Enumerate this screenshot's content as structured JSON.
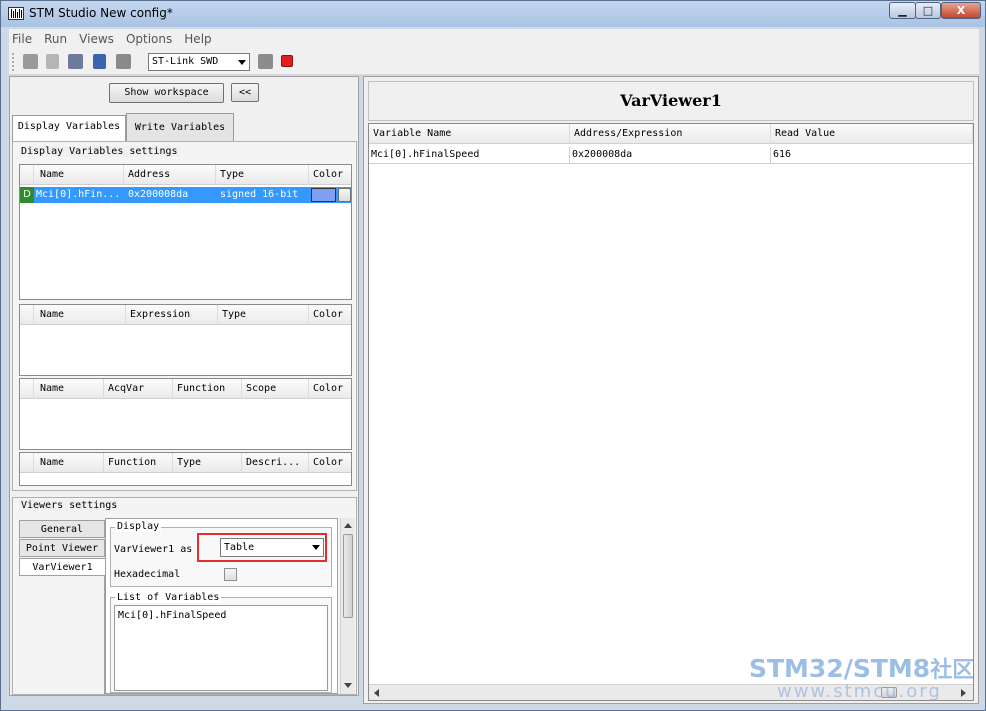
{
  "window": {
    "title": "STM Studio New config*",
    "controls": {
      "minimize": "▁",
      "maximize": "□",
      "close": "X"
    }
  },
  "menu": [
    "File",
    "Run",
    "Views",
    "Options",
    "Help"
  ],
  "toolbar": {
    "icons": [
      "open-folder-icon",
      "new-file-icon",
      "save-all-icon",
      "save-icon",
      "export-icon",
      "import-icon",
      "stop-icon"
    ],
    "probe_select": "ST-Link SWD"
  },
  "left": {
    "show_workspace": "Show workspace",
    "collapse": "<<",
    "tabs": [
      "Display Variables",
      "Write Variables"
    ],
    "display_settings_label": "Display Variables settings",
    "var_table": {
      "headers": [
        "Name",
        "Address",
        "Type",
        "Color"
      ],
      "rows": [
        {
          "badge": "D",
          "name": "Mci[0].hFin...",
          "address": "0x200008da",
          "type": "signed 16-bit",
          "color": "#7f9ff5"
        }
      ]
    },
    "expr_table": {
      "headers": [
        "Name",
        "Expression",
        "Type",
        "Color"
      ]
    },
    "acq_table": {
      "headers": [
        "Name",
        "AcqVar",
        "Function",
        "Scope",
        "Color"
      ]
    },
    "func_table": {
      "headers": [
        "Name",
        "Function",
        "Type",
        "Descri...",
        "Color"
      ]
    },
    "viewers_label": "Viewers settings",
    "viewer_tabs": [
      "General",
      "Point Viewer",
      "VarViewer1"
    ],
    "display_group": "Display",
    "view_as_label": "VarViewer1 as",
    "view_as_value": "Table",
    "hex_label": "Hexadecimal",
    "list_label": "List of Variables",
    "list_items": [
      "Mci[0].hFinalSpeed"
    ]
  },
  "viewer": {
    "title": "VarViewer1",
    "headers": [
      "Variable Name",
      "Address/Expression",
      "Read Value"
    ],
    "rows": [
      {
        "name": "Mci[0].hFinalSpeed",
        "address": "0x200008da",
        "value": "616"
      }
    ]
  },
  "watermark": {
    "line1a": "STM32",
    "line1b": "/",
    "line1c": "STM8",
    "line1d": "社区",
    "line2": "www.stmcu.org"
  }
}
